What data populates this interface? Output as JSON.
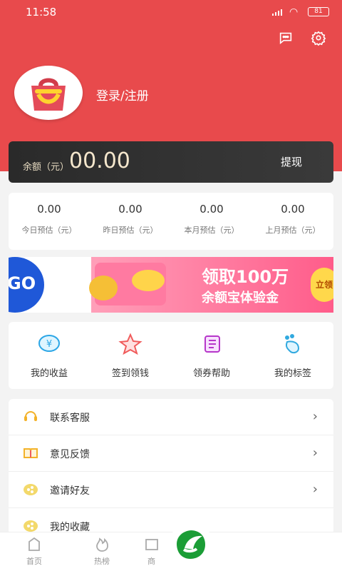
{
  "status_bar": {
    "time": "11:58",
    "battery": "81"
  },
  "header": {
    "login_text": "登录/注册"
  },
  "balance": {
    "label": "余额（元）",
    "value": "00.00",
    "withdraw": "提现"
  },
  "stats": [
    {
      "value": "0.00",
      "label": "今日预估（元）"
    },
    {
      "value": "0.00",
      "label": "昨日预估（元）"
    },
    {
      "value": "0.00",
      "label": "本月预估（元）"
    },
    {
      "value": "0.00",
      "label": "上月预估（元）"
    }
  ],
  "banner": {
    "left_text": "GO",
    "title": "领取100万",
    "subtitle": "余额宝体验金",
    "cta": "立领"
  },
  "tools": [
    {
      "label": "我的收益",
      "icon": "income-icon"
    },
    {
      "label": "签到领钱",
      "icon": "star-icon"
    },
    {
      "label": "领券帮助",
      "icon": "coupon-help-icon"
    },
    {
      "label": "我的标签",
      "icon": "tag-icon"
    }
  ],
  "menu": [
    {
      "label": "联系客服",
      "icon": "headset-icon"
    },
    {
      "label": "意见反馈",
      "icon": "feedback-icon"
    },
    {
      "label": "邀请好友",
      "icon": "invite-icon"
    },
    {
      "label": "我的收藏",
      "icon": "favorite-icon"
    }
  ],
  "tabs": [
    {
      "label": "首页",
      "icon": "home-icon"
    },
    {
      "label": "热榜",
      "icon": "fire-icon"
    },
    {
      "label": "商",
      "icon": "shop-icon"
    }
  ],
  "colors": {
    "primary": "#e84a4c",
    "balance_bg": "#2f2f2f",
    "menu_accent": "#f3b229"
  }
}
